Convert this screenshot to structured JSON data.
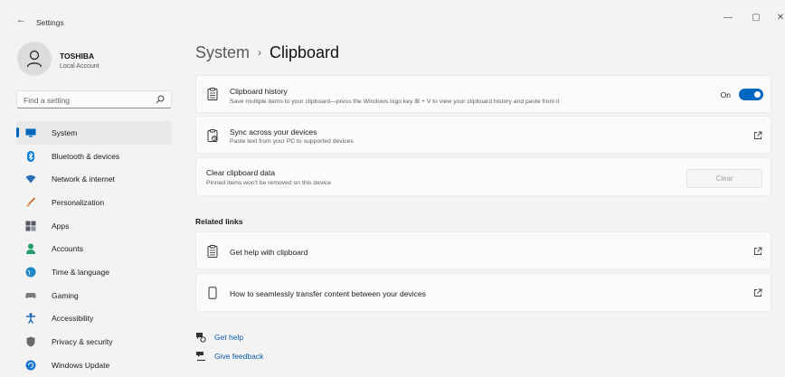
{
  "window": {
    "app_title": "Settings",
    "back_glyph": "←",
    "minimize_glyph": "—",
    "maximize_glyph": "▢",
    "close_glyph": "✕"
  },
  "profile": {
    "name": "TOSHIBA",
    "subtitle": "Local Account",
    "icon": "person-icon"
  },
  "search": {
    "placeholder": "Find a setting",
    "icon": "search-icon"
  },
  "sidebar": {
    "active_index": 0,
    "items": [
      {
        "label": "System",
        "icon": "monitor-icon",
        "color": "#0067c0"
      },
      {
        "label": "Bluetooth & devices",
        "icon": "bluetooth-icon",
        "color": "#0a7fd8"
      },
      {
        "label": "Network & internet",
        "icon": "wifi-icon",
        "color": "#2b6fb7"
      },
      {
        "label": "Personalization",
        "icon": "brush-icon",
        "color": "#c46a2a"
      },
      {
        "label": "Apps",
        "icon": "apps-icon",
        "color": "#555a66"
      },
      {
        "label": "Accounts",
        "icon": "accounts-icon",
        "color": "#22a06b"
      },
      {
        "label": "Time & language",
        "icon": "globe-icon",
        "color": "#1e88c7"
      },
      {
        "label": "Gaming",
        "icon": "gamepad-icon",
        "color": "#7a7a7a"
      },
      {
        "label": "Accessibility",
        "icon": "accessibility-icon",
        "color": "#1565c0"
      },
      {
        "label": "Privacy & security",
        "icon": "shield-icon",
        "color": "#6b6b6b"
      },
      {
        "label": "Windows Update",
        "icon": "update-icon",
        "color": "#1976d2"
      }
    ]
  },
  "breadcrumb": {
    "parent": "System",
    "separator": "›",
    "current": "Clipboard"
  },
  "cards": {
    "history": {
      "title": "Clipboard history",
      "description": "Save multiple items to your clipboard—press the Windows logo key ⊞ + V to view your clipboard history and paste from it",
      "toggle_label": "On",
      "toggle_on": true,
      "icon": "clipboard-icon"
    },
    "sync": {
      "title": "Sync across your devices",
      "description": "Paste text from your PC to supported devices",
      "icon": "clipboard-sync-icon"
    },
    "clear": {
      "title": "Clear clipboard data",
      "description": "Pinned items won't be removed on this device",
      "button_label": "Clear"
    }
  },
  "related": {
    "title": "Related links",
    "items": [
      {
        "label": "Get help with clipboard",
        "icon": "clipboard-icon"
      },
      {
        "label": "How to seamlessly transfer content between your devices",
        "icon": "phone-icon"
      }
    ]
  },
  "footer": {
    "help_label": "Get help",
    "feedback_label": "Give feedback"
  },
  "colors": {
    "accent": "#0067c0",
    "link": "#0a5aa8",
    "background": "#f3f3f3",
    "card": "#fbfbfb"
  }
}
